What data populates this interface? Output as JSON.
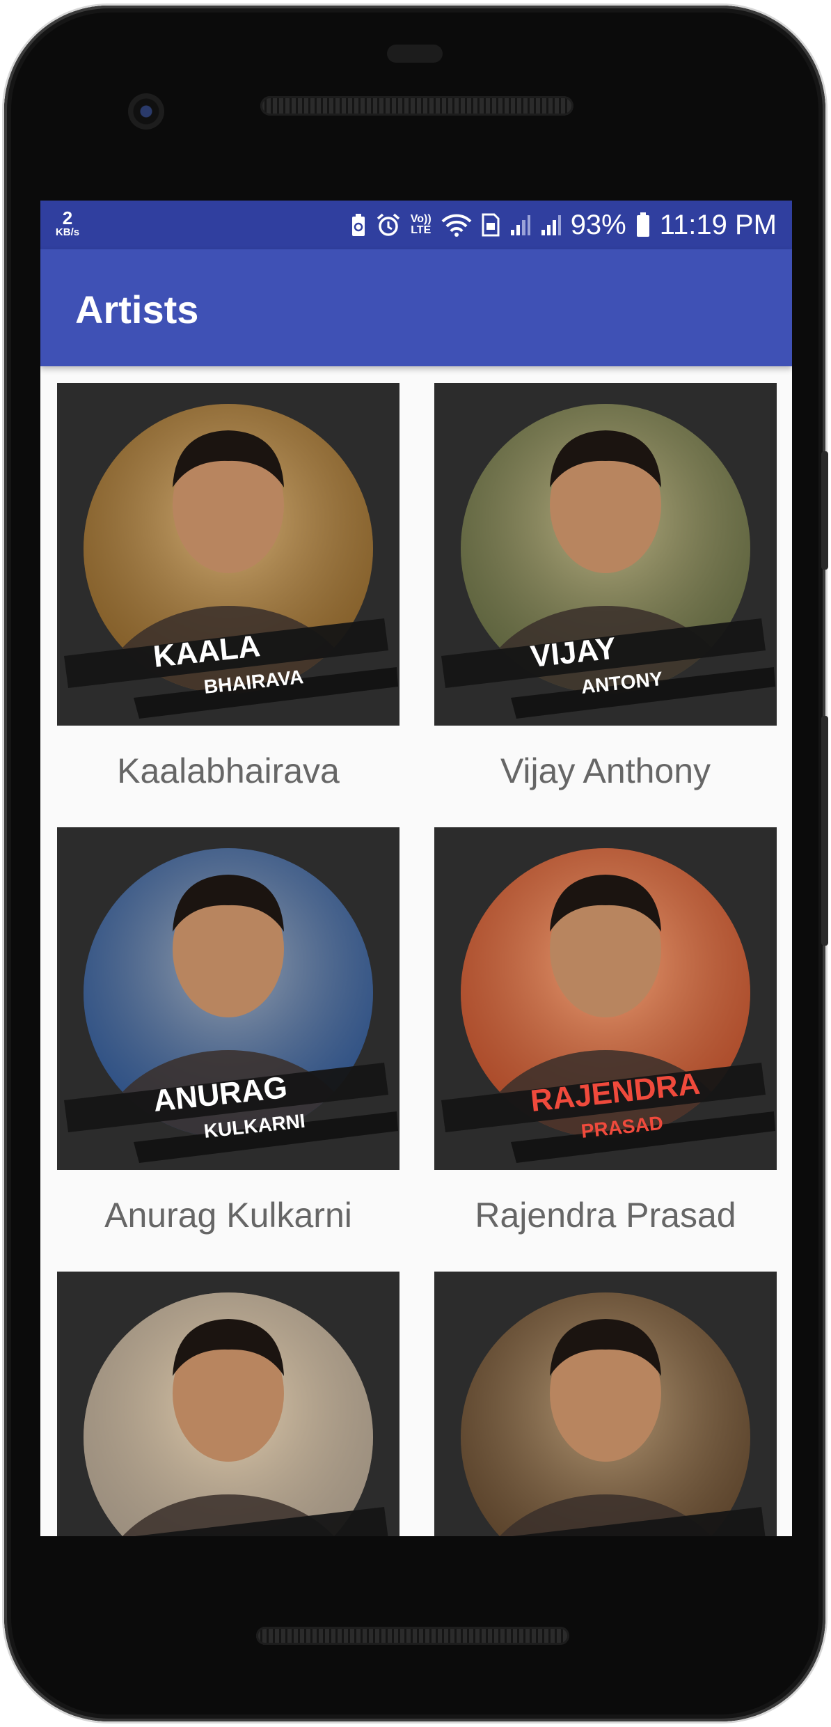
{
  "status_bar": {
    "speed_value": "2",
    "speed_unit": "KB/s",
    "volte_top": "Vo))",
    "volte_bottom": "LTE",
    "battery_percent": "93%",
    "time": "11:19 PM"
  },
  "app_bar": {
    "title": "Artists"
  },
  "artists": [
    {
      "name": "Kaalabhairava",
      "label_line1": "KAALA",
      "label_line2": "BHAIRAVA",
      "accent": "#ffffff",
      "photo_bg": "#a8742a"
    },
    {
      "name": "Vijay Anthony",
      "label_line1": "VIJAY",
      "label_line2": "ANTONY",
      "accent": "#ffffff",
      "photo_bg": "#6f7a48"
    },
    {
      "name": "Anurag Kulkarni",
      "label_line1": "ANURAG",
      "label_line2": "KULKARNI",
      "accent": "#ffffff",
      "photo_bg": "#2a5fb0"
    },
    {
      "name": "Rajendra Prasad",
      "label_line1": "RAJENDRA",
      "label_line2": "PRASAD",
      "accent": "#f04a3c",
      "photo_bg": "#e2562a"
    },
    {
      "name": "",
      "label_line1": "",
      "label_line2": "",
      "accent": "#ffffff",
      "photo_bg": "#c9b9a6"
    },
    {
      "name": "",
      "label_line1": "",
      "label_line2": "",
      "accent": "#ffffff",
      "photo_bg": "#6a4a2c"
    }
  ],
  "colors": {
    "status_bar": "#303f9f",
    "app_bar": "#3f51b5",
    "tile_bg": "#2c2c2c",
    "name_text": "#666666"
  }
}
